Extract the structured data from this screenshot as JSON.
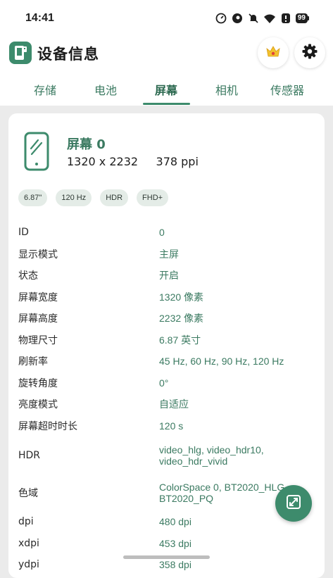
{
  "status_bar": {
    "time": "14:41",
    "battery": "99",
    "icons": [
      "speed-icon",
      "app-icon",
      "mute-icon",
      "wifi-icon",
      "alert-icon"
    ]
  },
  "header": {
    "title": "设备信息",
    "logo_icon": "app-logo-icon",
    "buttons": [
      "crown-icon",
      "gear-icon"
    ]
  },
  "tabs": [
    {
      "label": "存储",
      "active": false
    },
    {
      "label": "电池",
      "active": false
    },
    {
      "label": "屏幕",
      "active": true
    },
    {
      "label": "相机",
      "active": false
    },
    {
      "label": "传感器",
      "active": false
    }
  ],
  "screen": {
    "name": "屏幕 0",
    "resolution": "1320 x 2232",
    "ppi": "378 ppi",
    "chips": [
      "6.87\"",
      "120 Hz",
      "HDR",
      "FHD+"
    ]
  },
  "properties": [
    {
      "key": "ID",
      "value": "0"
    },
    {
      "key": "显示模式",
      "value": "主屏"
    },
    {
      "key": "状态",
      "value": "开启"
    },
    {
      "key": "屏幕宽度",
      "value": "1320 像素"
    },
    {
      "key": "屏幕高度",
      "value": "2232 像素"
    },
    {
      "key": "物理尺寸",
      "value": "6.87 英寸"
    },
    {
      "key": "刷新率",
      "value": "45 Hz, 60 Hz, 90 Hz, 120 Hz"
    },
    {
      "key": "旋转角度",
      "value": "0°"
    },
    {
      "key": "亮度模式",
      "value": "自适应"
    },
    {
      "key": "屏幕超时时长",
      "value": "120 s"
    },
    {
      "key": "HDR",
      "value": "video_hlg, video_hdr10,\nvideo_hdr_vivid"
    },
    {
      "key": "色域",
      "value": "ColorSpace 0, BT2020_HLG,\nBT2020_PQ"
    },
    {
      "key": "dpi",
      "value": "480 dpi"
    },
    {
      "key": "xdpi",
      "value": "453 dpi"
    },
    {
      "key": "ydpi",
      "value": "358 dpi"
    }
  ],
  "fab": {
    "icon": "expand-icon"
  },
  "colors": {
    "accent": "#3d8b6c",
    "accent_text": "#3b7a61",
    "chip_bg": "#e4ece7",
    "background": "#ebebeb"
  }
}
